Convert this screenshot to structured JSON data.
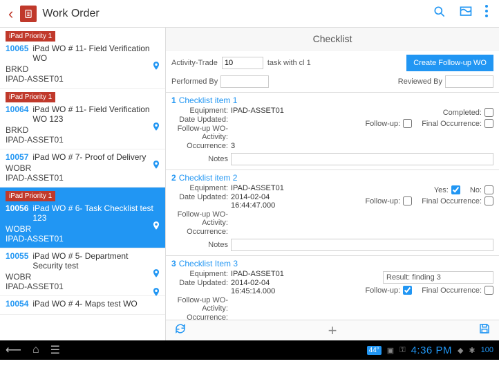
{
  "header": {
    "title": "Work Order"
  },
  "right_header": "Checklist",
  "sub": {
    "activity_label": "Activity-Trade",
    "activity_value": "10",
    "task_label": "task with cl 1",
    "create_btn": "Create Follow-up WO",
    "performed_by_label": "Performed By",
    "reviewed_by_label": "Reviewed By"
  },
  "left_items": [
    {
      "badge": "iPad Priority 1",
      "id": "10065",
      "title": "iPad WO # 11- Field Verification WO",
      "line1": "BRKD",
      "line2": "IPAD-ASSET01",
      "selected": false
    },
    {
      "badge": "iPad Priority 1",
      "id": "10064",
      "title": "iPad WO # 11- Field Verification WO 123",
      "line1": "BRKD",
      "line2": "IPAD-ASSET01",
      "selected": false
    },
    {
      "badge": "",
      "id": "10057",
      "title": "iPad WO # 7- Proof of Delivery",
      "line1": "WOBR",
      "line2": "IPAD-ASSET01",
      "selected": false
    },
    {
      "badge": "iPad Priority 1",
      "id": "10056",
      "title": "iPad WO # 6- Task Checklist test 123",
      "line1": "WOBR",
      "line2": "IPAD-ASSET01",
      "selected": true
    },
    {
      "badge": "",
      "id": "10055",
      "title": "iPad WO # 5- Department Security test",
      "line1": "WOBR",
      "line2": "IPAD-ASSET01",
      "selected": false
    },
    {
      "badge": "",
      "id": "10054",
      "title": "iPad WO # 4- Maps test WO",
      "line1": "",
      "line2": "",
      "selected": false
    }
  ],
  "labels": {
    "equipment": "Equipment:",
    "date_updated": "Date Updated:",
    "followup_act": "Follow-up WO-Activity:",
    "occurrence": "Occurrence:",
    "notes": "Notes",
    "completed": "Completed:",
    "followup": "Follow-up:",
    "final_occ": "Final Occurrence:",
    "yes": "Yes:",
    "no": "No:",
    "result": "Result:"
  },
  "checklist": [
    {
      "num": "1",
      "title": "Checklist item 1",
      "equipment": "IPAD-ASSET01",
      "date": "",
      "occ": "3",
      "type": "completed",
      "completed": false,
      "followup": false,
      "final": false
    },
    {
      "num": "2",
      "title": "Checklist item 2",
      "equipment": "IPAD-ASSET01",
      "date": "2014-02-04 16:44:47.000",
      "occ": "",
      "type": "yesno",
      "yes": true,
      "no": false,
      "followup": false,
      "final": false
    },
    {
      "num": "3",
      "title": "Checklist Item 3",
      "equipment": "IPAD-ASSET01",
      "date": "2014-02-04 16:45:14.000",
      "occ": "",
      "type": "result",
      "result": "finding 3",
      "followup": true,
      "final": false
    }
  ],
  "android": {
    "temp": "44°",
    "time": "4:36 PM",
    "batt": "100"
  }
}
